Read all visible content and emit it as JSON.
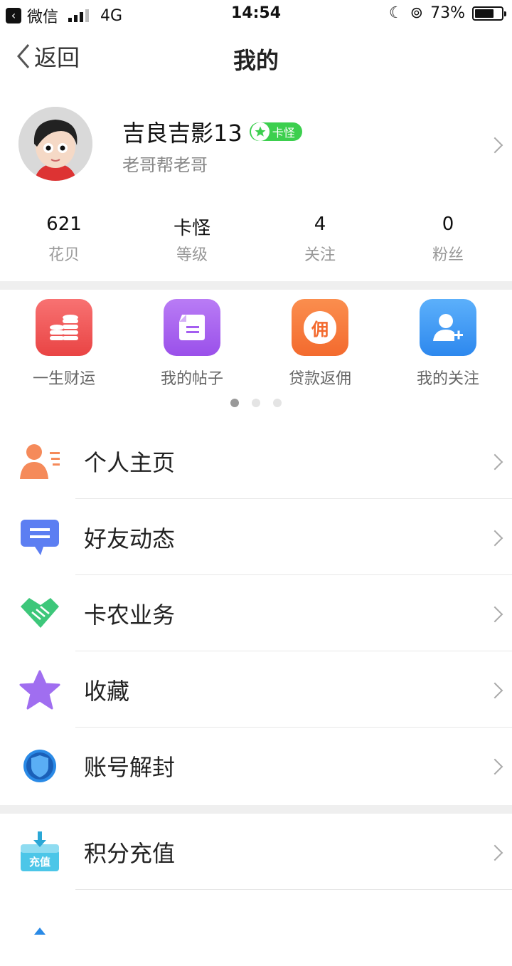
{
  "status_bar": {
    "app": "微信",
    "network": "4G",
    "time": "14:54",
    "battery": "73%",
    "battery_level": 0.73
  },
  "nav": {
    "back_label": "返回",
    "title": "我的"
  },
  "profile": {
    "name": "吉良吉影13",
    "badge": "卡怪",
    "subtitle": "老哥帮老哥"
  },
  "stats": [
    {
      "value": "621",
      "label": "花贝"
    },
    {
      "value": "卡怪",
      "label": "等级"
    },
    {
      "value": "4",
      "label": "关注"
    },
    {
      "value": "0",
      "label": "粉丝"
    }
  ],
  "quick_actions": [
    {
      "label": "一生财运",
      "icon": "coins-icon",
      "color": "#f05a5a"
    },
    {
      "label": "我的帖子",
      "icon": "document-icon",
      "color": "#a45ef0"
    },
    {
      "label": "贷款返佣",
      "icon": "money-bag-icon",
      "color": "#f57b3e",
      "glyph": "佣"
    },
    {
      "label": "我的关注",
      "icon": "user-add-icon",
      "color": "#3b97f3"
    }
  ],
  "pager": {
    "count": 3,
    "active": 1
  },
  "menu_group1": [
    {
      "label": "个人主页",
      "icon": "person-list-icon"
    },
    {
      "label": "好友动态",
      "icon": "chat-bubble-icon"
    },
    {
      "label": "卡农业务",
      "icon": "handshake-icon"
    },
    {
      "label": "收藏",
      "icon": "star-icon"
    },
    {
      "label": "账号解封",
      "icon": "shield-icon"
    }
  ],
  "menu_group2": [
    {
      "label": "积分充值",
      "icon": "recharge-box-icon",
      "glyph": "充值"
    }
  ],
  "colors": {
    "badge": "#3ccf4e",
    "separator": "#efefef"
  }
}
